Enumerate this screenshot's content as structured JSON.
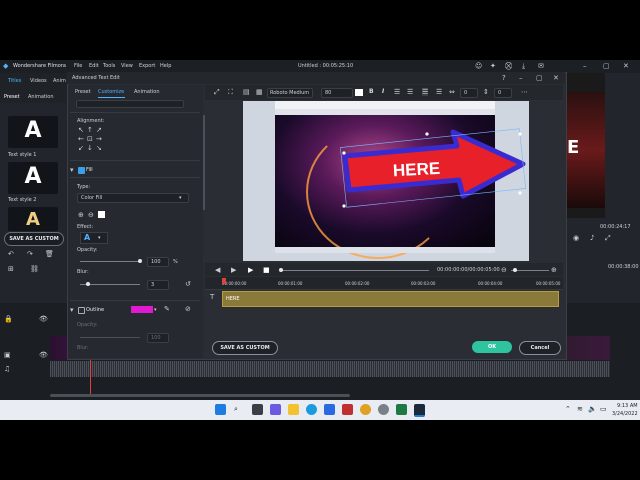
{
  "app": {
    "title": "Wondershare Filmora",
    "menu": [
      "File",
      "Edit",
      "Tools",
      "View",
      "Export",
      "Help"
    ],
    "project_title": "Untitled : 00:05:25:10",
    "media_tabs": [
      "Titles",
      "Videos",
      "Anim"
    ],
    "preset_tabs": [
      "Preset",
      "Animation"
    ],
    "text_styles": [
      {
        "letter": "A",
        "label": "Text style 1"
      },
      {
        "letter": "A",
        "label": "Text style 2"
      },
      {
        "letter": "A",
        "label": ""
      }
    ],
    "save_as_custom": "SAVE AS CUSTOM",
    "right_time": "00:00:24:17",
    "right_time2": "00:00:38:00"
  },
  "dialog": {
    "title": "Advanced Text Edit",
    "tabs": [
      "Preset",
      "Customize",
      "Animation"
    ],
    "active_tab": "Customize",
    "alignment_label": "Alignment:",
    "fill": {
      "label": "Fill",
      "checked": true,
      "type_label": "Type:",
      "type_value": "Color Fill",
      "effect_label": "Effect:",
      "opacity_label": "Opacity:",
      "opacity_value": "100",
      "opacity_unit": "%",
      "blur_label": "Blur:",
      "blur_value": "3"
    },
    "outline": {
      "label": "Outline",
      "color": "#e01ad0",
      "opacity_label": "Opacity:",
      "opacity_value": "100",
      "blur_label": "Blur:"
    },
    "toolbar": {
      "font": "Roboto Medium",
      "size": "80",
      "bold": "B",
      "italic": "I",
      "spacing": "0",
      "line_spacing": "0"
    },
    "preview": {
      "arrow_text": "HERE",
      "arrow_color": "#e8202a",
      "arrow_outline": "#3a2bd0"
    },
    "playback": {
      "timecode": "00:00:00:00/00:00:05:00"
    },
    "ruler": [
      "00:00:00:00",
      "00:00:01:00",
      "00:00:02:00",
      "00:00:03:00",
      "00:00:04:00",
      "00:00:05:00"
    ],
    "track_label": "HERE",
    "footer": {
      "save_as_custom": "SAVE AS CUSTOM",
      "ok": "OK",
      "cancel": "Cancel"
    }
  },
  "taskbar": {
    "time": "9:13 AM",
    "date": "3/24/2022"
  },
  "colors": {
    "accent_teal": "#2fc4a0",
    "dialog_bg": "#2a2e34",
    "track_gold": "#8a7a3a"
  }
}
